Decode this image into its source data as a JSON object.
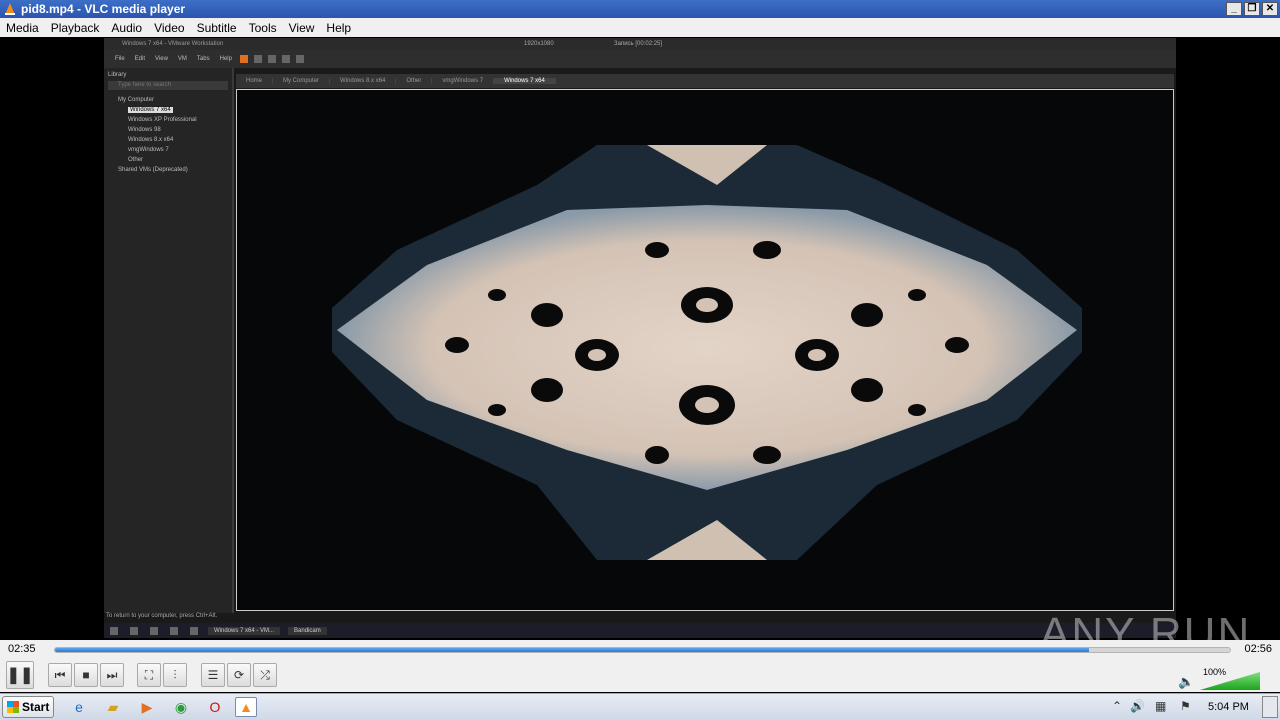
{
  "window": {
    "title": "pid8.mp4 - VLC media player"
  },
  "menu": [
    "Media",
    "Playback",
    "Audio",
    "Video",
    "Subtitle",
    "Tools",
    "View",
    "Help"
  ],
  "video": {
    "vm_title": "Windows 7 x64 - VMware Workstation",
    "vm_resolution": "1920x1080",
    "vm_recording": "Запись [00:02:25]",
    "vm_menu": [
      "File",
      "Edit",
      "View",
      "VM",
      "Tabs",
      "Help"
    ],
    "library": {
      "heading": "Library",
      "search_placeholder": "Type here to search",
      "root": "My Computer",
      "items": [
        "Windows 7 x64",
        "Windows XP Professional",
        "Windows 98",
        "Windows 8.x x64",
        "vmgWindows 7",
        "Other"
      ],
      "shared": "Shared VMs (Deprecated)"
    },
    "tabs": [
      "Home",
      "My Computer",
      "Windows 8.x x64",
      "Other",
      "vmgWindows 7",
      "Windows 7 x64"
    ],
    "status_hint": "To return to your computer, press Ctrl+Alt.",
    "taskbar_tasks": [
      "Windows 7 x64 - VM...",
      "Bandicam"
    ],
    "watermark": "ANY RUN"
  },
  "playback": {
    "current_time": "02:35",
    "total_time": "02:56",
    "progress": 0.88
  },
  "volume": {
    "percent_label": "100%",
    "level": 1.0
  },
  "controls": [
    "play-pause",
    "previous",
    "stop",
    "next",
    "fullscreen",
    "extended-settings",
    "playlist",
    "loop",
    "random"
  ],
  "taskbar": {
    "start_label": "Start",
    "clock": "5:04 PM"
  }
}
